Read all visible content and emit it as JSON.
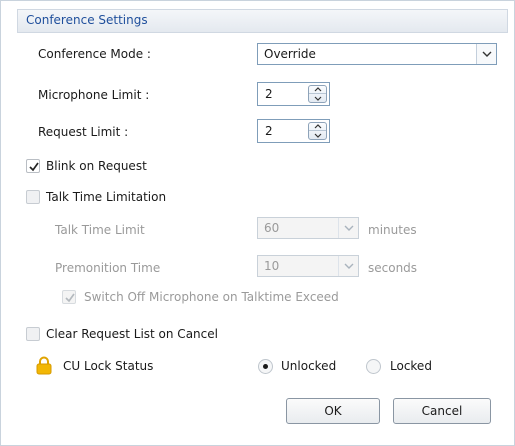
{
  "header": {
    "title": "Conference Settings"
  },
  "conference_mode": {
    "label": "Conference Mode :",
    "selected": "Override"
  },
  "microphone_limit": {
    "label": "Microphone Limit :",
    "value": "2"
  },
  "request_limit": {
    "label": "Request Limit :",
    "value": "2"
  },
  "blink_on_request": {
    "label": "Blink on Request",
    "checked": true
  },
  "talk_time_limitation": {
    "label": "Talk Time Limitation",
    "checked": false
  },
  "talk_time_limit": {
    "label": "Talk Time Limit",
    "selected": "60",
    "unit": "minutes"
  },
  "premonition_time": {
    "label": "Premonition Time",
    "selected": "10",
    "unit": "seconds"
  },
  "switch_off_microphone": {
    "label": "Switch Off Microphone on Talktime Exceed",
    "checked": true
  },
  "clear_request_list": {
    "label": "Clear Request List on Cancel",
    "checked": false
  },
  "cu_lock": {
    "label": "CU Lock Status",
    "options": [
      "Unlocked",
      "Locked"
    ],
    "selected": "Unlocked"
  },
  "buttons": {
    "ok": "OK",
    "cancel": "Cancel"
  },
  "colors": {
    "header_text": "#1f4f9c",
    "lock_icon": "#f2b705",
    "disabled_text": "#9a9a9a"
  },
  "icons": {
    "lock": "lock-icon",
    "check": "check-icon",
    "dropdown": "chevron-down-icon"
  }
}
